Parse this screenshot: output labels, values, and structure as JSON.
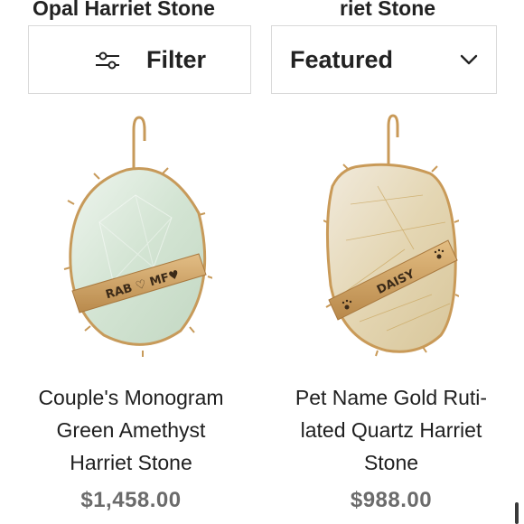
{
  "header": {
    "cut_title_left": "Opal Harriet Stone",
    "cut_title_right": "riet Stone"
  },
  "toolbar": {
    "filter_label": "Filter",
    "filter_icon": "sliders-icon",
    "sort_label": "Featured",
    "sort_icon": "chevron-down-icon"
  },
  "products": [
    {
      "name_lines": [
        "Couple's Monogram",
        "Green Amethyst",
        "Harriet Stone"
      ],
      "engraving": "RAB ♡ MF♥",
      "price": "$1,458.00",
      "stone_color": "#dbe9dc",
      "metal_color": "#c79a5a"
    },
    {
      "name_lines": [
        "Pet Name Gold Ruti-",
        "lated Quartz Harriet",
        "Stone"
      ],
      "engraving": "DAISY",
      "price": "$988.00",
      "stone_color": "#e7dcbf",
      "metal_color": "#c99a58"
    }
  ]
}
